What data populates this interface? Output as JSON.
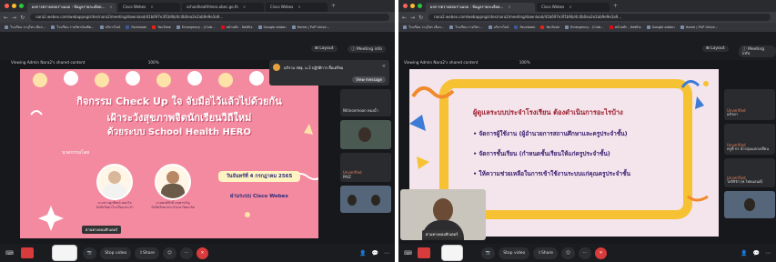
{
  "left": {
    "tabs": [
      {
        "label": "ผลการตรวจสอบร่างแบบ : ข้อมูลรายละเอียด...",
        "active": true
      },
      {
        "label": "Cisco Webex",
        "active": false
      },
      {
        "label": "schoolhealthhero.obec.go.th",
        "active": false
      },
      {
        "label": "Cisco Webex",
        "active": false
      }
    ],
    "url": "nara2.webex.com/webappng/sites/nara2/meeting/download/d1b697e3f1b9b/4c4b0ea2e2ab9e9e3a9...",
    "bookmarks": [
      "โรงเรียน ระบุโทร เลือก...",
      "โรงเรียน รายวิชาบัณฑิต...",
      "บริการไลน์",
      "Facebook",
      "YouTube",
      "Emergency - (Club...",
      "หน้าหลัก - Netflix",
      "Google addon",
      "Home | PuP Unive..."
    ],
    "top_buttons": {
      "layout": "Layout",
      "meeting_info": "Meeting info"
    },
    "share_bar": {
      "viewing": "Viewing Admin Nara2's shared content",
      "zoom": "100%"
    },
    "slide": {
      "title1": "กิจกรรม Check Up ใจ จับมือไว้แล้วไปด้วยกัน",
      "title2": "เฝ้าระวังสุขภาพจิตนักเรียนวิถีใหม่",
      "title3": "ด้วยระบบ School Health HERO",
      "speakers_label": "นวดกรรมโดย",
      "speaker1_name": "นางสาวศุภพิชฌ์ สมถวิล",
      "speaker1_role": "นักจิตวิทยาโรงเรียนประจำ",
      "speaker2_name": "นายพงษ์ศักดิ์ สมุทรขวัญ",
      "speaker2_role": "นักจิตวิทยาประจำมหาวิทยาลัย",
      "date": "วันจันทร์ที่ 4 กรกฎาคม 2565",
      "platform": "ผ่านระบบ Cisco Webex",
      "presenter_label": "ผ่านทางคอมพิวเตอร์"
    },
    "chat": {
      "sender": "อภิราม สพฐ. ม.3 ปฏิบัติการ ยิ้มเตรียม",
      "button": "View message"
    },
    "participants": [
      {
        "name": "Nitinonmoon ทองน้ำ",
        "status": ""
      },
      {
        "name": "",
        "status": ""
      },
      {
        "name": "PAIZ",
        "status": "Unverified"
      },
      {
        "name": "",
        "status": ""
      }
    ],
    "controls": {
      "stop_video": "Stop video",
      "share": "Share"
    }
  },
  "right": {
    "tabs": [
      {
        "label": "ผลการตรวจสอบร่างแบบ : ข้อมูลรายละเอียด...",
        "active": true
      },
      {
        "label": "Cisco Webex",
        "active": false
      }
    ],
    "url": "nara2.webex.com/webappng/sites/nara2/meeting/download/d1b697e3f1b9b/4c4b0ea2e2ab9e9e3a9...",
    "bookmarks": [
      "โรงเรียน ระบุโทร เลือก...",
      "โรงเรียน รายวิชา...",
      "บริการไลน์",
      "Facebook",
      "YouTube",
      "Emergency - (Club...",
      "หน้าหลัก - Netflix",
      "Google addon",
      "Home | PuP Unive..."
    ],
    "top_buttons": {
      "layout": "Layout",
      "meeting_info": "Meeting info"
    },
    "share_bar": {
      "viewing": "Viewing Admin Nara2's shared content",
      "zoom": "100%"
    },
    "slide": {
      "heading": "ผู้ดูแลระบบประจำโรงเรียน ต้องดำเนินการอะไรบ้าง",
      "bullets": [
        "จัดการผู้ใช้งาน (ผู้อำนวยการสถานศึกษาและครูประจำชั้น)",
        "จัดการชั้นเรียน (กำหนดชั้นเรียนให้แก่ครูประจำชั้น)",
        "ให้ความช่วยเหลือในการเข้าใช้งานระบบแก่คุณครูประจำชั้น"
      ],
      "presenter_label": "ผ่านทางคอมพิวเตอร์"
    },
    "participants": [
      {
        "name": "อภิรดา",
        "status": "Unverified"
      },
      {
        "name": "ครูพี่ กร นำกลุ่มแลกเปลี่ยน",
        "status": "Unverified"
      },
      {
        "name": "โยจิจิรัก (ท.ไทยแลนด์)",
        "status": "Unverified"
      },
      {
        "name": "",
        "status": ""
      }
    ],
    "controls": {
      "stop_video": "Stop video",
      "share": "Share"
    }
  },
  "colors": {
    "left_slide_bg": "#f48aa0",
    "right_slide_bg": "#f4e4ec",
    "right_frame": "#f6c234",
    "heading_color": "#9a2030",
    "bullet_color": "#3a1d6e",
    "end_call": "#d83b3b"
  }
}
